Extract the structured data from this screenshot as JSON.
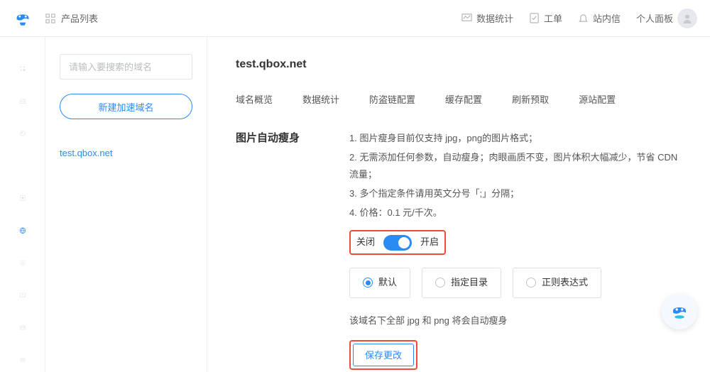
{
  "breadcrumb": {
    "label": "产品列表"
  },
  "top_nav": {
    "stats": "数据统计",
    "ticket": "工单",
    "inbox": "站内信",
    "profile": "个人面板"
  },
  "sidebar": {
    "search_placeholder": "请输入要搜索的域名",
    "new_domain": "新建加速域名",
    "domain_item": "test.qbox.net"
  },
  "main": {
    "domain": "test.qbox.net",
    "tabs": {
      "overview": "域名概览",
      "stats": "数据统计",
      "antileech": "防盗链配置",
      "cache": "缓存配置",
      "refresh": "刷新预取",
      "origin": "源站配置"
    },
    "section_title": "图片自动瘦身",
    "desc": {
      "l1": "1. 图片瘦身目前仅支持 jpg，png的图片格式；",
      "l2": "2. 无需添加任何参数，自动瘦身；肉眼画质不变，图片体积大幅减少，节省 CDN 流量；",
      "l3": "3. 多个指定条件请用英文分号「;」分隔；",
      "l4": "4. 价格：0.1 元/千次。"
    },
    "toggle": {
      "off": "关闭",
      "on": "开启"
    },
    "radio": {
      "default": "默认",
      "dir": "指定目录",
      "regex": "正则表达式"
    },
    "helper": "该域名下全部 jpg 和 png 将会自动瘦身",
    "save": "保存更改"
  }
}
